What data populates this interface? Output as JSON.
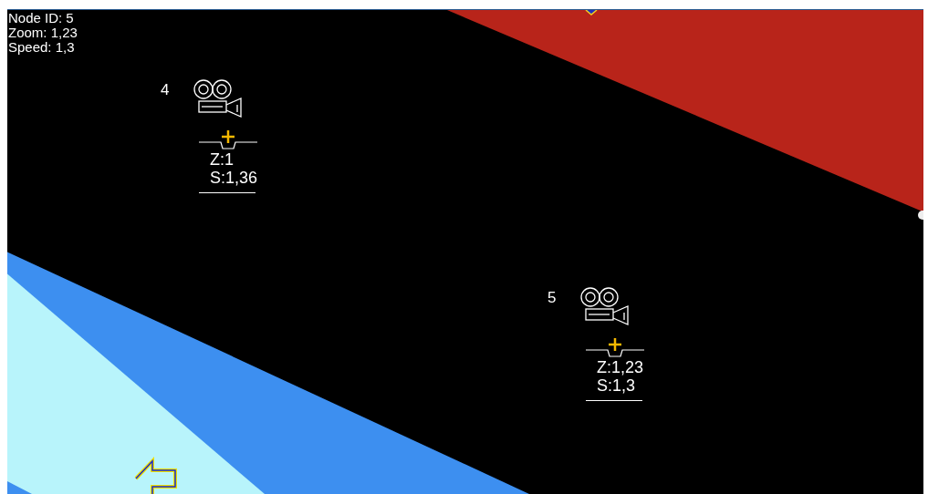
{
  "info": [
    "Node ID: 5",
    "Zoom: 1,23",
    "Speed: 1,3"
  ],
  "nodes": [
    {
      "id": "4",
      "zoom": "Z:1",
      "speed": "S:1,36"
    },
    {
      "id": "5",
      "zoom": "Z:1,23",
      "speed": "S:1,3"
    }
  ]
}
